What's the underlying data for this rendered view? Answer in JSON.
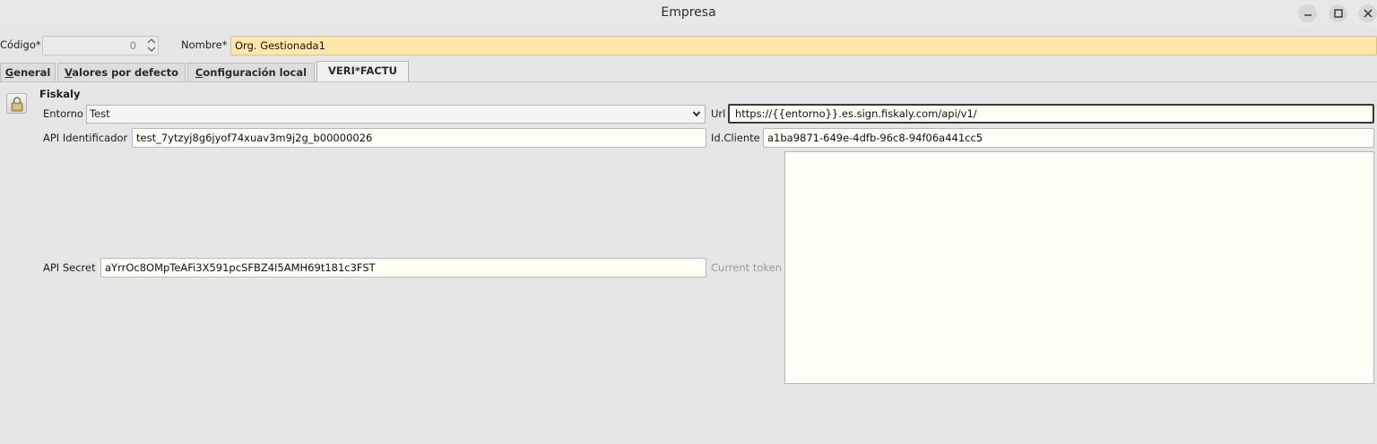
{
  "window": {
    "title": "Empresa"
  },
  "header": {
    "codigo_label": "Código*",
    "codigo_value": "0",
    "nombre_label": "Nombre*",
    "nombre_value": "Org. Gestionada1"
  },
  "tabs": [
    {
      "label": "General",
      "underline": "G",
      "rest": "eneral"
    },
    {
      "label": "Valores por defecto",
      "underline": "V",
      "rest": "alores por defecto"
    },
    {
      "label": "Configuración local",
      "underline": "C",
      "rest": "onfiguración local"
    },
    {
      "label": "VERI*FACTU",
      "active": true
    }
  ],
  "section": {
    "title": "Fiskaly"
  },
  "form": {
    "entorno_label": "Entorno",
    "entorno_value": "Test",
    "url_label": "Url",
    "url_value": "https://{{entorno}}.es.sign.fiskaly.com/api/v1/",
    "api_id_label": "API Identificador",
    "api_id_value": "test_7ytzyj8g6jyof74xuav3m9j2g_b00000026",
    "id_cliente_label": "Id.Cliente",
    "id_cliente_value": "a1ba9871-649e-4dfb-96c8-94f06a441cc5",
    "api_secret_label": "API Secret",
    "api_secret_value": "aYrrOc8OMpTeAFi3X591pcSFBZ4I5AMH69t181c3FST",
    "current_token_label": "Current token",
    "current_token_value": ""
  },
  "icons": {
    "minimize": "minimize-icon",
    "maximize": "maximize-icon",
    "close": "close-icon",
    "lock": "lock-icon",
    "spinner": "spinner-arrows-icon",
    "dropdown": "chevron-down-icon"
  }
}
